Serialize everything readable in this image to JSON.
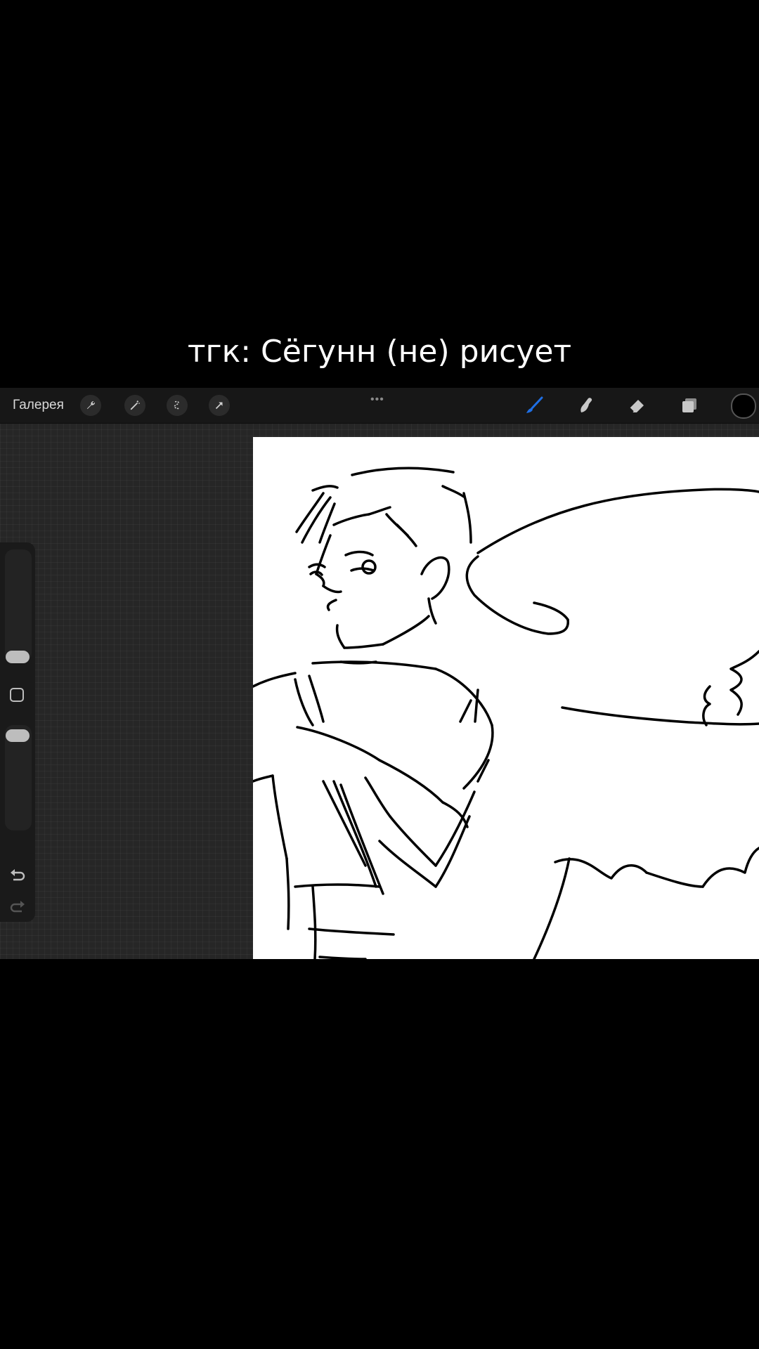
{
  "caption": "тгк: Сёгунн (не) рисует",
  "toolbar": {
    "gallery_label": "Галерея",
    "left_tools": [
      "wrench-icon",
      "magic-wand-icon",
      "selection-icon",
      "transform-arrow-icon"
    ],
    "more_indicator": "•••",
    "right_tools": [
      "brush-icon",
      "smudge-icon",
      "eraser-icon",
      "layers-icon"
    ],
    "brush_active_color": "#1f6fe5",
    "current_color": "#000000"
  },
  "sidebar": {
    "controls": [
      "brush-size-slider",
      "modify-button",
      "opacity-slider",
      "undo-icon",
      "redo-icon"
    ]
  },
  "canvas": {
    "background": "#ffffff",
    "content": "line sketch of a man with wings"
  }
}
